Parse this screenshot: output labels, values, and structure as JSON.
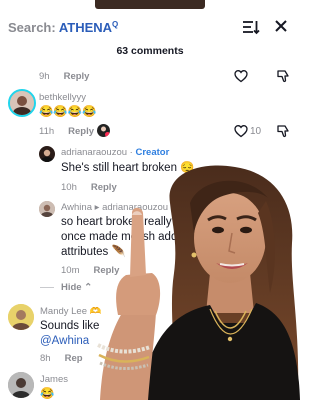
{
  "header": {
    "search_prefix": "Search: ",
    "search_term": "ATHENA",
    "search_glyph": "Q",
    "sort_icon": "sort-icon",
    "close_icon": "close-icon"
  },
  "comments_count": "63 comments",
  "comments": [
    {
      "time": "9h",
      "reply": "Reply"
    },
    {
      "username": "bethkellyyy",
      "text": "😂😂😂😂",
      "time": "11h",
      "reply": "Reply",
      "likes": "10"
    },
    {
      "username": "adrianaraouzou",
      "separator": " · ",
      "badge": "Creator",
      "text": "She's still heart broken 😔",
      "time": "10h",
      "reply": "Reply"
    },
    {
      "username": "Awhina",
      "separator": " ▸ ",
      "reply_to": "adrianaraouzou",
      "text_line1": "so heart broke ​I really miss",
      "text_line2": "once made me ​ish add th",
      "text_line3": "attributes 🪶",
      "time": "10m",
      "reply": "Reply"
    },
    {
      "hide": "Hide ⌃"
    },
    {
      "username": "Mandy Lee 🫶",
      "text": "Sounds like",
      "mention": "@Awhina",
      "time": "8h",
      "reply": "Rep"
    },
    {
      "username": "James",
      "text": "😂"
    }
  ],
  "colors": {
    "accent": "#2b5db9",
    "creator": "#2f7fe0",
    "muted": "#8a8b91",
    "text": "#161823"
  }
}
